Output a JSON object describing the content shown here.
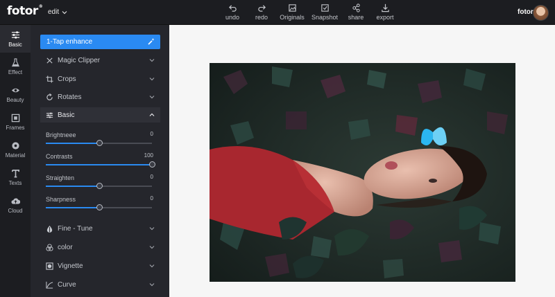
{
  "app": {
    "logo": "fotor",
    "logo_mark": "®",
    "edit_menu": "edit"
  },
  "toolbar": [
    {
      "label": "undo",
      "icon": "undo-icon"
    },
    {
      "label": "redo",
      "icon": "redo-icon"
    },
    {
      "label": "Originals",
      "icon": "originals-icon"
    },
    {
      "label": "Snapshot",
      "icon": "snapshot-icon"
    },
    {
      "label": "share",
      "icon": "share-icon"
    },
    {
      "label": "export",
      "icon": "export-icon"
    }
  ],
  "user": {
    "name": "fotor"
  },
  "rail": [
    {
      "label": "Basic",
      "icon": "sliders-icon",
      "active": true
    },
    {
      "label": "Effect",
      "icon": "flask-icon"
    },
    {
      "label": "Beauty",
      "icon": "eye-icon"
    },
    {
      "label": "Frames",
      "icon": "frame-icon"
    },
    {
      "label": "Material",
      "icon": "flower-icon"
    },
    {
      "label": "Texts",
      "icon": "text-icon"
    },
    {
      "label": "Cloud",
      "icon": "cloud-icon"
    }
  ],
  "panel": {
    "enhance_label": "1-Tap enhance",
    "sections_top": [
      {
        "label": "Magic Clipper",
        "icon": "scissors-icon"
      },
      {
        "label": "Crops",
        "icon": "crop-icon"
      },
      {
        "label": "Rotates",
        "icon": "rotate-icon"
      }
    ],
    "basic": {
      "label": "Basic",
      "sliders": [
        {
          "label": "Brightneee",
          "value": "0",
          "fraction": 0.5
        },
        {
          "label": "Contrasts",
          "value": "100",
          "fraction": 1.0
        },
        {
          "label": "Straighten",
          "value": "0",
          "fraction": 0.5
        },
        {
          "label": "Sharpness",
          "value": "0",
          "fraction": 0.5
        }
      ]
    },
    "sections_bottom": [
      {
        "label": "Fine - Tune",
        "icon": "droplet-icon"
      },
      {
        "label": "color",
        "icon": "color-circles-icon"
      },
      {
        "label": "Vignette",
        "icon": "vignette-icon"
      },
      {
        "label": "Curve",
        "icon": "curve-icon"
      }
    ]
  },
  "colors": {
    "accent": "#2a8af2",
    "topbar": "#1c1d21",
    "panel": "#25262c"
  }
}
